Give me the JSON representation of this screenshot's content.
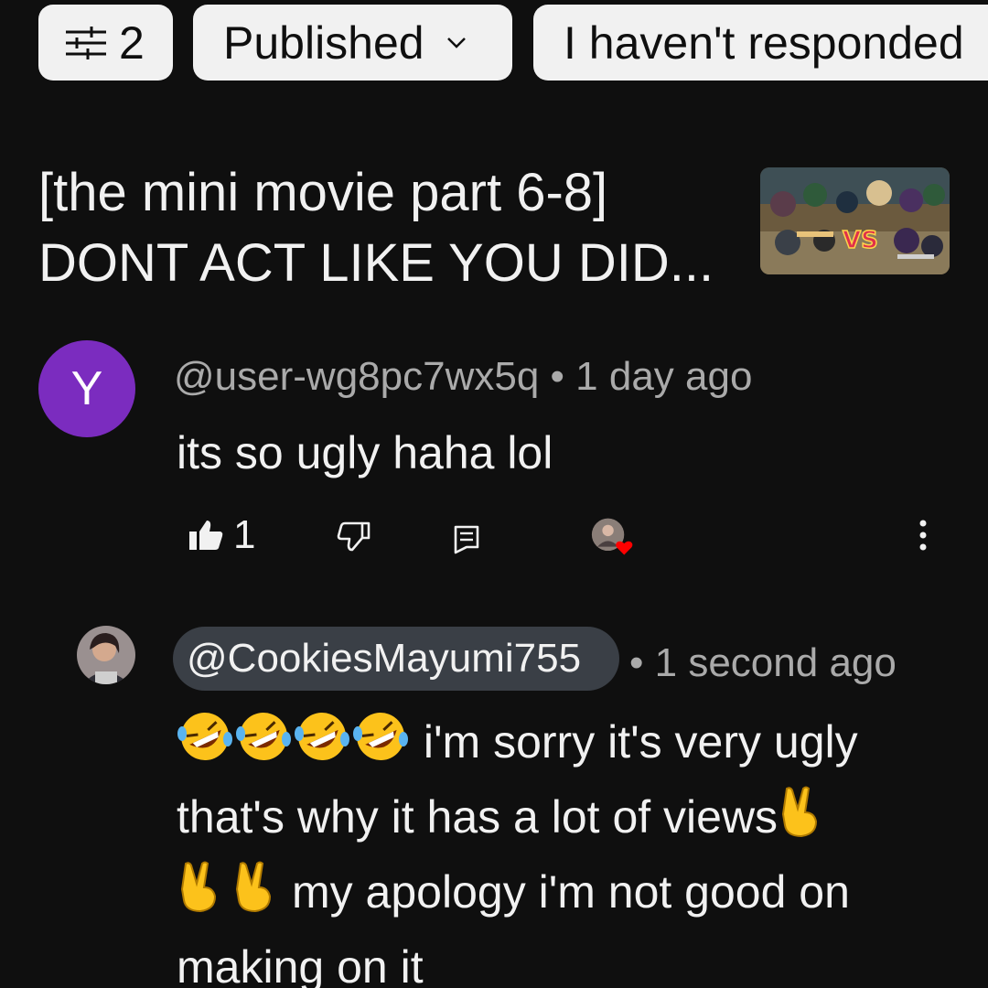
{
  "filter_bar": {
    "filter_count": "2",
    "published_label": "Published",
    "unresponded_label": "I haven't responded"
  },
  "video": {
    "title": "[the mini movie part 6-8] DONT ACT LIKE YOU DID...",
    "thumbnail_text": "VS"
  },
  "comment": {
    "avatar_letter": "Y",
    "avatar_color": "#7b2cbf",
    "author": "@user-wg8pc7wx5q",
    "separator": "•",
    "time": "1 day ago",
    "text": "its so ugly haha lol",
    "like_count": "1"
  },
  "reply": {
    "mention": "@CookiesMayumi755",
    "separator": "•",
    "time": "1 second ago",
    "text_line1": "i'm sorry it's very ugly",
    "text_line2": "that's why it has a lot of views",
    "text_line3": "my apology i'm not good on",
    "text_line4": "making on it"
  },
  "icons": {
    "filter": "filter-sliders-icon",
    "chevron": "chevron-down-icon",
    "like": "thumbs-up-icon",
    "dislike": "thumbs-down-icon",
    "reply": "reply-icon",
    "heart": "heart-icon",
    "more": "more-vertical-icon",
    "laugh_emoji": "rolling-on-floor-laughing-emoji",
    "victory_emoji": "victory-hand-emoji"
  }
}
